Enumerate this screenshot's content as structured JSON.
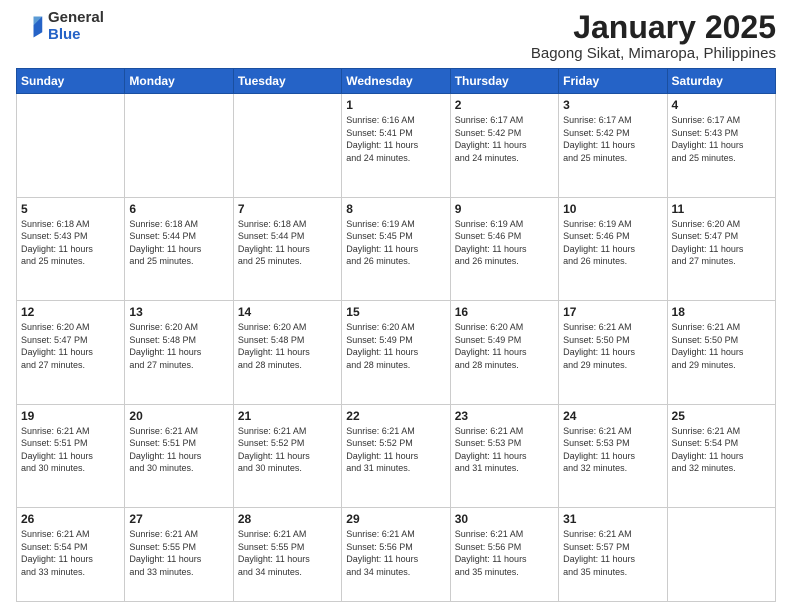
{
  "header": {
    "logo_general": "General",
    "logo_blue": "Blue",
    "title": "January 2025",
    "subtitle": "Bagong Sikat, Mimaropa, Philippines"
  },
  "weekdays": [
    "Sunday",
    "Monday",
    "Tuesday",
    "Wednesday",
    "Thursday",
    "Friday",
    "Saturday"
  ],
  "weeks": [
    [
      {
        "day": "",
        "info": ""
      },
      {
        "day": "",
        "info": ""
      },
      {
        "day": "",
        "info": ""
      },
      {
        "day": "1",
        "info": "Sunrise: 6:16 AM\nSunset: 5:41 PM\nDaylight: 11 hours\nand 24 minutes."
      },
      {
        "day": "2",
        "info": "Sunrise: 6:17 AM\nSunset: 5:42 PM\nDaylight: 11 hours\nand 24 minutes."
      },
      {
        "day": "3",
        "info": "Sunrise: 6:17 AM\nSunset: 5:42 PM\nDaylight: 11 hours\nand 25 minutes."
      },
      {
        "day": "4",
        "info": "Sunrise: 6:17 AM\nSunset: 5:43 PM\nDaylight: 11 hours\nand 25 minutes."
      }
    ],
    [
      {
        "day": "5",
        "info": "Sunrise: 6:18 AM\nSunset: 5:43 PM\nDaylight: 11 hours\nand 25 minutes."
      },
      {
        "day": "6",
        "info": "Sunrise: 6:18 AM\nSunset: 5:44 PM\nDaylight: 11 hours\nand 25 minutes."
      },
      {
        "day": "7",
        "info": "Sunrise: 6:18 AM\nSunset: 5:44 PM\nDaylight: 11 hours\nand 25 minutes."
      },
      {
        "day": "8",
        "info": "Sunrise: 6:19 AM\nSunset: 5:45 PM\nDaylight: 11 hours\nand 26 minutes."
      },
      {
        "day": "9",
        "info": "Sunrise: 6:19 AM\nSunset: 5:46 PM\nDaylight: 11 hours\nand 26 minutes."
      },
      {
        "day": "10",
        "info": "Sunrise: 6:19 AM\nSunset: 5:46 PM\nDaylight: 11 hours\nand 26 minutes."
      },
      {
        "day": "11",
        "info": "Sunrise: 6:20 AM\nSunset: 5:47 PM\nDaylight: 11 hours\nand 27 minutes."
      }
    ],
    [
      {
        "day": "12",
        "info": "Sunrise: 6:20 AM\nSunset: 5:47 PM\nDaylight: 11 hours\nand 27 minutes."
      },
      {
        "day": "13",
        "info": "Sunrise: 6:20 AM\nSunset: 5:48 PM\nDaylight: 11 hours\nand 27 minutes."
      },
      {
        "day": "14",
        "info": "Sunrise: 6:20 AM\nSunset: 5:48 PM\nDaylight: 11 hours\nand 28 minutes."
      },
      {
        "day": "15",
        "info": "Sunrise: 6:20 AM\nSunset: 5:49 PM\nDaylight: 11 hours\nand 28 minutes."
      },
      {
        "day": "16",
        "info": "Sunrise: 6:20 AM\nSunset: 5:49 PM\nDaylight: 11 hours\nand 28 minutes."
      },
      {
        "day": "17",
        "info": "Sunrise: 6:21 AM\nSunset: 5:50 PM\nDaylight: 11 hours\nand 29 minutes."
      },
      {
        "day": "18",
        "info": "Sunrise: 6:21 AM\nSunset: 5:50 PM\nDaylight: 11 hours\nand 29 minutes."
      }
    ],
    [
      {
        "day": "19",
        "info": "Sunrise: 6:21 AM\nSunset: 5:51 PM\nDaylight: 11 hours\nand 30 minutes."
      },
      {
        "day": "20",
        "info": "Sunrise: 6:21 AM\nSunset: 5:51 PM\nDaylight: 11 hours\nand 30 minutes."
      },
      {
        "day": "21",
        "info": "Sunrise: 6:21 AM\nSunset: 5:52 PM\nDaylight: 11 hours\nand 30 minutes."
      },
      {
        "day": "22",
        "info": "Sunrise: 6:21 AM\nSunset: 5:52 PM\nDaylight: 11 hours\nand 31 minutes."
      },
      {
        "day": "23",
        "info": "Sunrise: 6:21 AM\nSunset: 5:53 PM\nDaylight: 11 hours\nand 31 minutes."
      },
      {
        "day": "24",
        "info": "Sunrise: 6:21 AM\nSunset: 5:53 PM\nDaylight: 11 hours\nand 32 minutes."
      },
      {
        "day": "25",
        "info": "Sunrise: 6:21 AM\nSunset: 5:54 PM\nDaylight: 11 hours\nand 32 minutes."
      }
    ],
    [
      {
        "day": "26",
        "info": "Sunrise: 6:21 AM\nSunset: 5:54 PM\nDaylight: 11 hours\nand 33 minutes."
      },
      {
        "day": "27",
        "info": "Sunrise: 6:21 AM\nSunset: 5:55 PM\nDaylight: 11 hours\nand 33 minutes."
      },
      {
        "day": "28",
        "info": "Sunrise: 6:21 AM\nSunset: 5:55 PM\nDaylight: 11 hours\nand 34 minutes."
      },
      {
        "day": "29",
        "info": "Sunrise: 6:21 AM\nSunset: 5:56 PM\nDaylight: 11 hours\nand 34 minutes."
      },
      {
        "day": "30",
        "info": "Sunrise: 6:21 AM\nSunset: 5:56 PM\nDaylight: 11 hours\nand 35 minutes."
      },
      {
        "day": "31",
        "info": "Sunrise: 6:21 AM\nSunset: 5:57 PM\nDaylight: 11 hours\nand 35 minutes."
      },
      {
        "day": "",
        "info": ""
      }
    ]
  ]
}
